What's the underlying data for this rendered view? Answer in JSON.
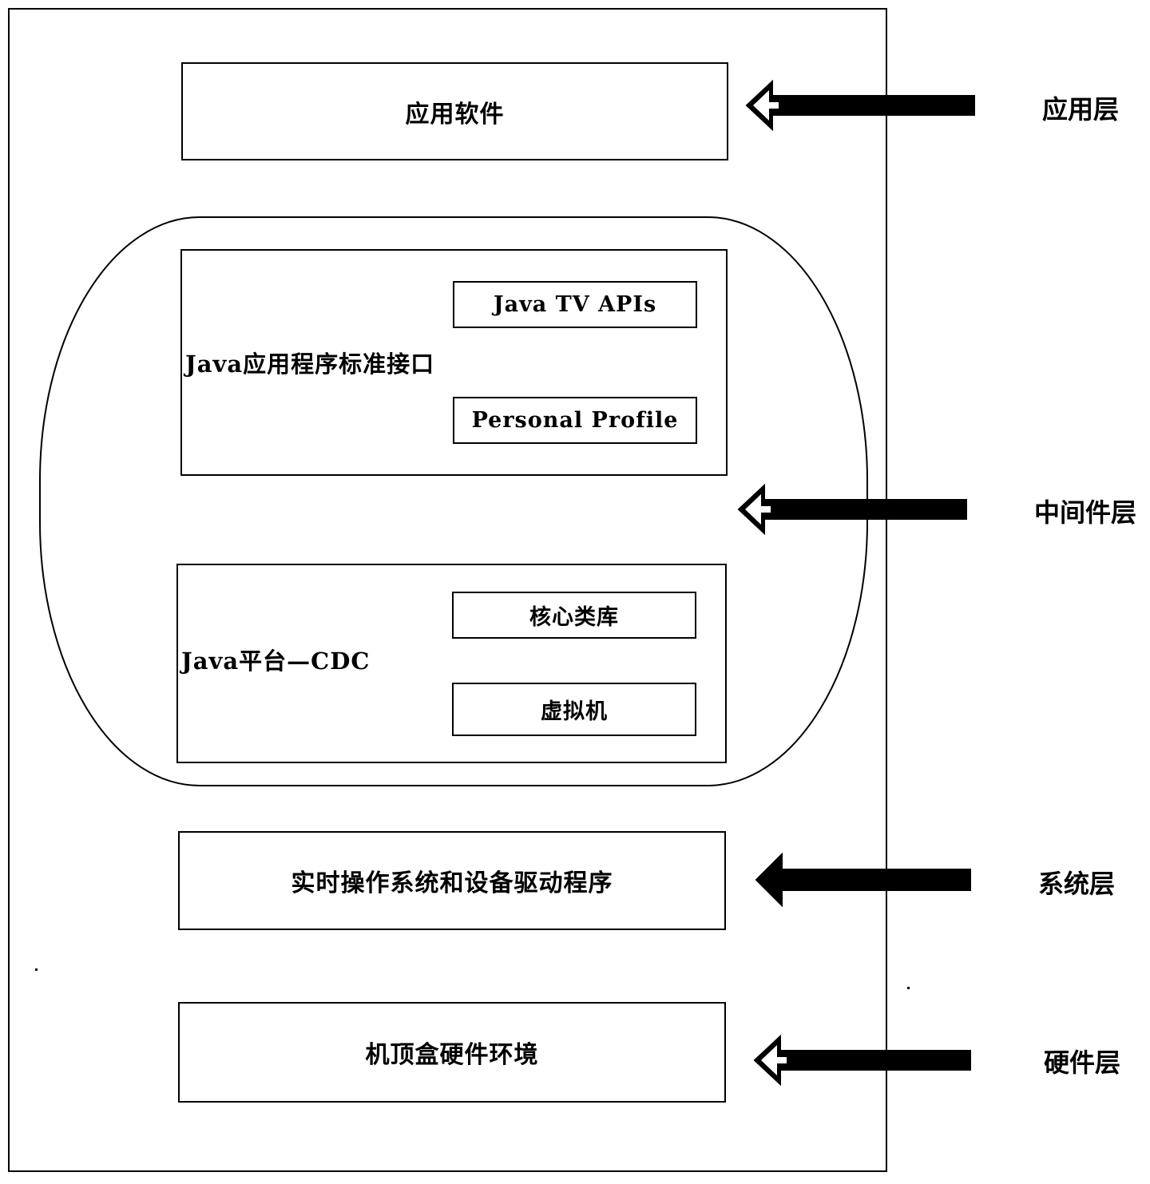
{
  "diagram": {
    "title": "",
    "layers": [
      {
        "id": "application",
        "label": "应用层"
      },
      {
        "id": "middleware",
        "label": "中间件层"
      },
      {
        "id": "system",
        "label": "系统层"
      },
      {
        "id": "hardware",
        "label": "硬件层"
      }
    ],
    "boxes": {
      "application_software": "应用软件",
      "java_app_std_interface": {
        "label": "Java应用程序标准接口",
        "children": [
          "Java TV APIs",
          "Personal Profile"
        ]
      },
      "java_platform_cdc": {
        "label": "Java平台—CDC",
        "children": [
          "核心类库",
          "虚拟机"
        ]
      },
      "rtos_drivers": "实时操作系统和设备驱动程序",
      "stb_hardware": "机顶盒硬件环境"
    },
    "connectors": [
      {
        "from": "应用层",
        "to": "应用软件",
        "type": "arrow-left"
      },
      {
        "from": "中间件层",
        "to": "middleware-ellipse",
        "type": "arrow-left"
      },
      {
        "from": "系统层",
        "to": "实时操作系统和设备驱动程序",
        "type": "arrow-left"
      },
      {
        "from": "硬件层",
        "to": "机顶盒硬件环境",
        "type": "arrow-left"
      }
    ]
  }
}
